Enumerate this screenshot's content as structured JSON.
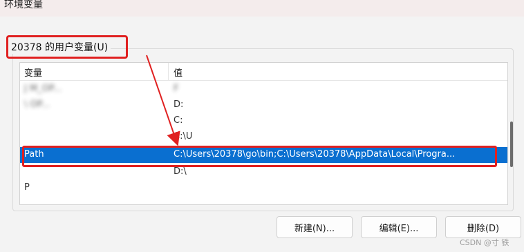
{
  "window": {
    "title": "环境变量"
  },
  "group": {
    "label": "20378 的用户变量(U)"
  },
  "table": {
    "columns": [
      "变量",
      "值"
    ],
    "rows": [
      {
        "name": "J              M_OP...",
        "value": "F",
        "selected": false,
        "obscured": true
      },
      {
        "name": "                 \\ OP...",
        "value": "D:",
        "selected": false,
        "obscured": true
      },
      {
        "name": "",
        "value": "C:",
        "selected": false,
        "obscured": true
      },
      {
        "name": "",
        "value": "C:\\U",
        "selected": false,
        "obscured": true
      },
      {
        "name": "Path",
        "value": "C:\\Users\\20378\\go\\bin;C:\\Users\\20378\\AppData\\Local\\Progra...",
        "selected": true,
        "obscured": false
      },
      {
        "name": "",
        "value": "D:\\",
        "selected": false,
        "obscured": true
      },
      {
        "name": "P",
        "value": "",
        "selected": false,
        "obscured": true
      }
    ]
  },
  "buttons": {
    "new": "新建(N)...",
    "edit": "编辑(E)...",
    "delete": "删除(D)"
  },
  "watermark": "CSDN @寸 铁",
  "colors": {
    "selection": "#0a6fd0",
    "annotation": "#e02020"
  }
}
